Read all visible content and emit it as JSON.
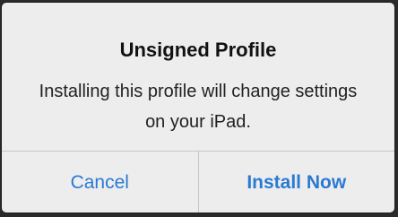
{
  "alert": {
    "title": "Unsigned Profile",
    "message": "Installing this profile will change settings on your iPad.",
    "cancel_label": "Cancel",
    "install_label": "Install Now"
  },
  "colors": {
    "accent": "#2a7ad3",
    "background": "#ededed",
    "separator": "#c6c6c6"
  }
}
